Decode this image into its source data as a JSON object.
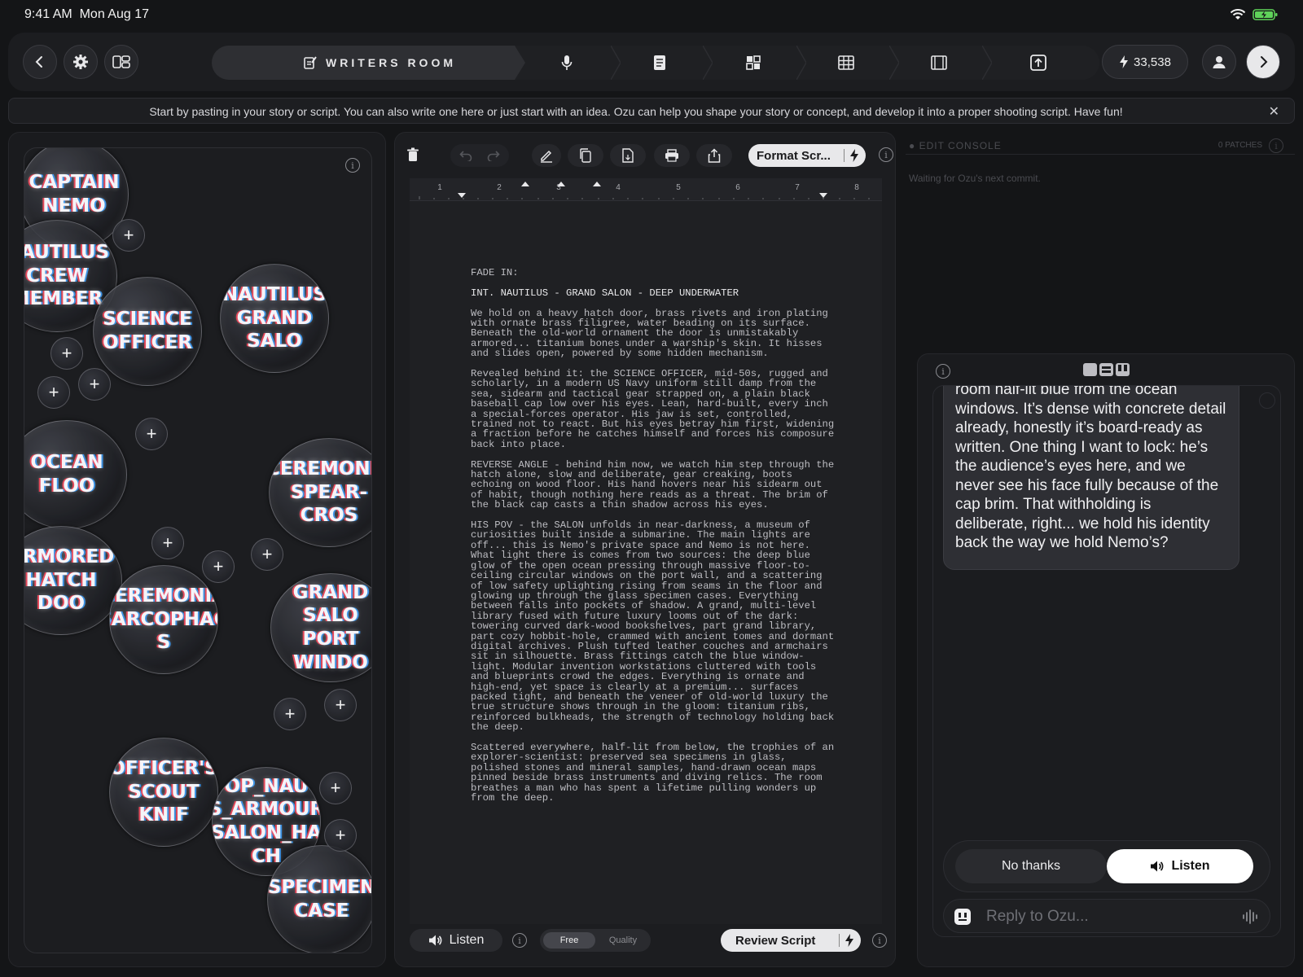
{
  "status": {
    "time": "9:41 AM",
    "date": "Mon Aug 17"
  },
  "topbar": {
    "stage_label": "WRITERS ROOM",
    "credits": "33,538"
  },
  "banner": {
    "text": "Start by pasting in your story or script. You can also write one here or just start with an idea. Ozu can help you shape your story or concept, and develop it into a proper shooting script. Have fun!",
    "close": "✕"
  },
  "elements_board": {
    "bubbles": [
      {
        "label": "CAPTAIN\nNEMO"
      },
      {
        "label": "NAUTILUS\nCREW\nMEMBER"
      },
      {
        "label": "SCIENCE\nOFFICER"
      },
      {
        "label": "NAUTILUS\nGRAND SALO"
      },
      {
        "label": "OCEAN FLOO"
      },
      {
        "label": "CEREMONIA\nSPEAR-CROS"
      },
      {
        "label": "ARMORED\nHATCH DOO"
      },
      {
        "label": "CEREMONIA\nSARCOPHAG\nS"
      },
      {
        "label": "GRAND SALO\nPORT WINDO"
      },
      {
        "label": "OFFICER'S\nSCOUT KNIF"
      },
      {
        "label": "OP_NAU\nS_ARMOUR\nSALON_HA\nCH"
      },
      {
        "label": "SPECIMEN\nCASE"
      }
    ]
  },
  "editor": {
    "format_label": "Format Scr...",
    "ruler_ticks": [
      "1",
      "2",
      "3",
      "4",
      "5",
      "6",
      "7",
      "8"
    ],
    "script": {
      "fade_in": "FADE IN:",
      "slug": "INT. NAUTILUS - GRAND SALON - DEEP UNDERWATER",
      "p1": "We hold on a heavy hatch door, brass rivets and iron plating with ornate brass filigree, water beading on its surface. Beneath the old-world ornament the door is unmistakably armored... titanium bones under a warship's skin. It hisses and slides open, powered by some hidden mechanism.",
      "p2": "Revealed behind it: the SCIENCE OFFICER, mid-50s, rugged and scholarly, in a modern US Navy uniform still damp from the sea, sidearm and tactical gear strapped on, a plain black baseball cap low over his eyes. Lean, hard-built, every inch a special-forces operator. His jaw is set, controlled, trained not to react. But his eyes betray him first, widening a fraction before he catches himself and forces his composure back into place.",
      "p3": "REVERSE ANGLE - behind him now, we watch him step through the hatch alone, slow and deliberate, gear creaking, boots echoing on wood floor. His hand hovers near his sidearm out of habit, though nothing here reads as a threat. The brim of the black cap casts a thin shadow across his eyes.",
      "p4": "HIS POV - the SALON unfolds in near-darkness, a museum of curiosities built inside a submarine. The main lights are off... this is Nemo's private space and Nemo is not here. What light there is comes from two sources: the deep blue glow of the open ocean pressing through massive floor-to-ceiling circular windows on the port wall, and a scattering of low safety uplighting rising from seams in the floor and glowing up through the glass specimen cases. Everything between falls into pockets of shadow. A grand, multi-level library fused with future luxury looms out of the dark: towering curved dark-wood bookshelves, part grand library, part cozy hobbit-hole, crammed with ancient tomes and dormant digital archives. Plush tufted leather couches and armchairs sit in silhouette. Brass fittings catch the blue window-light. Modular invention workstations cluttered with tools and blueprints crowd the edges. Everything is ornate and high-end, yet space is clearly at a premium... surfaces packed tight, and beneath the veneer of old-world luxury the true structure shows through in the gloom: titanium ribs, reinforced bulkheads, the strength of technology holding back the deep.",
      "p5": "Scattered everywhere, half-lit from below, the trophies of an explorer-scientist: preserved sea specimens in glass, polished stones and mineral samples, hand-drawn ocean maps pinned beside brass instruments and diving relics. The room breathes a man who has spent a lifetime pulling wonders up from the deep."
    },
    "listen_label": "Listen",
    "toggle": {
      "free": "Free",
      "quality": "Quality"
    },
    "review_label": "Review Script"
  },
  "console": {
    "title": "EDIT CONSOLE",
    "patches": "0 PATCHES",
    "message": "Waiting for Ozu's next commit."
  },
  "chat": {
    "message": "room half-lit blue from the ocean windows. It’s dense with concrete detail already, honestly it’s board-ready as written. One thing I want to lock: he’s the audience’s eyes here, and we never see his face fully because of the cap brim. That withholding is deliberate, right... we hold his identity back the way we hold Nemo’s?",
    "no_label": "No thanks",
    "listen_label": "Listen",
    "reply_placeholder": "Reply to Ozu..."
  },
  "colors": {
    "background": "#141517",
    "panel": "#1c1d20",
    "accent_light": "#e8e8ea",
    "battery": "#5fd35a"
  }
}
